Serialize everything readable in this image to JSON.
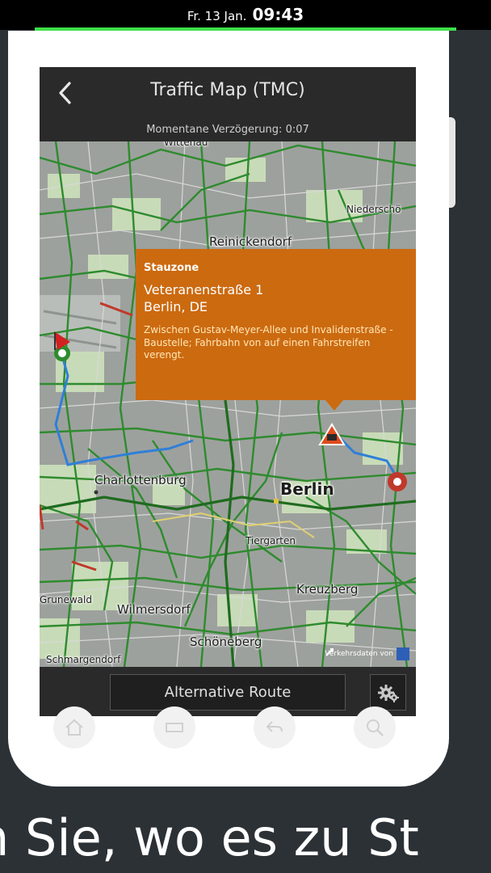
{
  "status_bar": {
    "date": "Fr. 13 Jan.",
    "time": "09:43",
    "progress": 1.0
  },
  "app_bar": {
    "back_icon": "chevron-left-icon",
    "title": "Traffic Map (TMC)",
    "delay_text": "Momentane Verzögerung: 0:07"
  },
  "map": {
    "labels": {
      "wittenau": "Wittenau",
      "niederschoe": "Niederschö",
      "reinickendorf": "Reinickendorf",
      "charlottenburg": "Charlottenburg",
      "berlin": "Berlin",
      "tiergarten": "Tiergarten",
      "kreuzberg": "Kreuzberg",
      "grunewald": "Grunewald",
      "wilmersdorf": "Wilmersdorf",
      "schoeneberg": "Schöneberg",
      "schmargendorf": "Schmargendorf"
    },
    "credit": "Verkehrsdaten von"
  },
  "popup": {
    "title": "Stauzone",
    "street": "Veteranenstraße 1",
    "city": "Berlin, DE",
    "description": "Zwischen Gustav-Meyer-Allee und Invalidenstraße - Baustelle; Fahrbahn von auf einen Fahrstreifen verengt."
  },
  "bottom_bar": {
    "alt_route_label": "Alternative Route",
    "settings_icon": "gear-icon"
  },
  "device_nav": [
    "home-icon",
    "menu-icon",
    "back-icon",
    "search-icon"
  ],
  "caption": "n Sie, wo es zu St",
  "colors": {
    "accent_green": "#3fe04a",
    "popup_orange": "#cc6a10",
    "route_blue": "#2f7fd8",
    "traffic_green": "#2e8b2e",
    "traffic_red": "#c0392b"
  }
}
